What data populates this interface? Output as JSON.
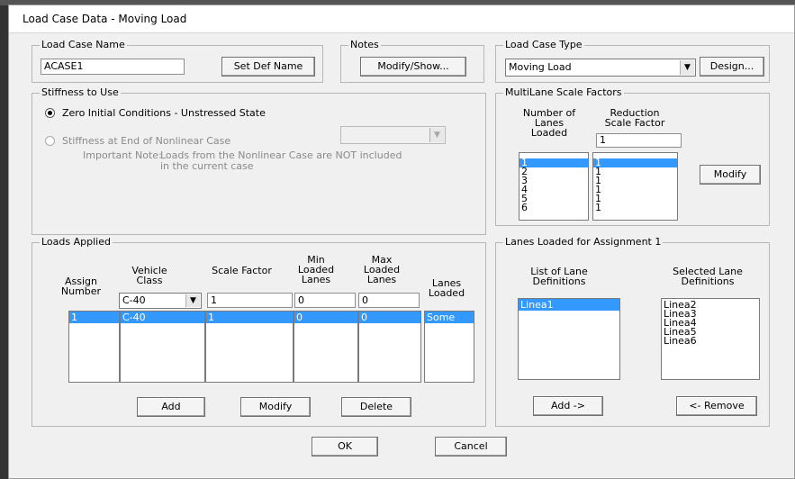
{
  "window": {
    "title": "Load Case Data - Moving Load"
  },
  "load_case_name": {
    "label": "Load Case Name",
    "value": "ACASE1",
    "set_def_name_button": "Set Def Name"
  },
  "notes": {
    "label": "Notes",
    "button": "Modify/Show..."
  },
  "load_case_type": {
    "label": "Load Case Type",
    "value": "Moving Load",
    "design_button": "Design..."
  },
  "stiffness": {
    "label": "Stiffness to Use",
    "option1": "Zero Initial Conditions - Unstressed State",
    "option2": "Stiffness at End of Nonlinear Case",
    "selected": "option1",
    "nonlinear_case_value": "",
    "note_label": "Important Note:",
    "note_line1": "Loads from the Nonlinear Case are NOT included",
    "note_line2": "in the current case"
  },
  "multilane": {
    "label": "MultiLane Scale Factors",
    "col1_header": [
      "Number of",
      "Lanes",
      "Loaded"
    ],
    "col2_header": [
      "Reduction",
      "Scale Factor"
    ],
    "edit_value": "1",
    "lanes": [
      "1",
      "2",
      "3",
      "4",
      "5",
      "6"
    ],
    "factors": [
      "1",
      "1",
      "1",
      "1",
      "1",
      "1"
    ],
    "selected_index": 0,
    "modify_button": "Modify"
  },
  "loads_applied": {
    "label": "Loads Applied",
    "headers": {
      "assign_number": [
        "Assign",
        "Number"
      ],
      "vehicle_class": [
        "Vehicle",
        "Class"
      ],
      "scale_factor": [
        "Scale Factor"
      ],
      "min_loaded_lanes": [
        "Min",
        "Loaded",
        "Lanes"
      ],
      "max_loaded_lanes": [
        "Max",
        "Loaded",
        "Lanes"
      ],
      "lanes_loaded": [
        "Lanes",
        "Loaded"
      ]
    },
    "edit_row": {
      "vehicle_class": "C-40",
      "scale_factor": "1",
      "min": "0",
      "max": "0"
    },
    "rows": [
      {
        "assign": "1",
        "vehicle_class": "C-40",
        "scale_factor": "1",
        "min": "0",
        "max": "0",
        "lanes_loaded": "Some"
      }
    ],
    "add_button": "Add",
    "modify_button": "Modify",
    "delete_button": "Delete"
  },
  "lanes_assignment": {
    "label": "Lanes Loaded for Assignment 1",
    "list_header": [
      "List of Lane",
      "Definitions"
    ],
    "selected_header": [
      "Selected Lane",
      "Definitions"
    ],
    "available": [
      "Linea1"
    ],
    "selected": [
      "Linea2",
      "Linea3",
      "Linea4",
      "Linea5",
      "Linea6"
    ],
    "add_button": "Add ->",
    "remove_button": "<- Remove"
  },
  "footer": {
    "ok_button": "OK",
    "cancel_button": "Cancel"
  },
  "colors": {
    "selection": "#3399ff",
    "dialog_bg": "#f0f0f0",
    "group_border": "#b6b6b6"
  }
}
